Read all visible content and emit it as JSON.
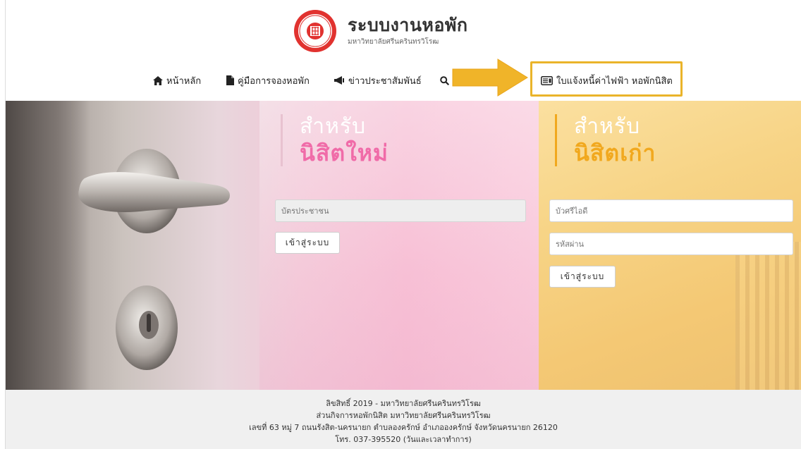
{
  "header": {
    "title": "ระบบงานหอพัก",
    "subtitle": "มหาวิทยาลัยศรีนครินทรวิโรฒ",
    "seal_text": "มหาวิทยาลัยศรีนครินทรวิโรฒ"
  },
  "nav": {
    "home": "หน้าหลัก",
    "manual": "คู่มือการจองหอพัก",
    "news": "ข่าวประชาสัมพันธ์",
    "bill": "ใบแจ้งหนี้ค่าไฟฟ้า หอพักนิสิต",
    "search_partial": "("
  },
  "new_students": {
    "line1": "สำหรับ",
    "line2": "นิสิตใหม่",
    "id_placeholder": "บัตรประชาชน",
    "login_label": "เข้าสู่ระบบ"
  },
  "old_students": {
    "line1": "สำหรับ",
    "line2": "นิสิตเก่า",
    "buasri_placeholder": "บัวศรีไอดี",
    "password_placeholder": "รหัสผ่าน",
    "login_label": "เข้าสู่ระบบ"
  },
  "footer": {
    "copyright": "ลิขสิทธิ์ 2019 - มหาวิทยาลัยศรีนครินทรวิโรฒ",
    "division": "ส่วนกิจการหอพักนิสิต มหาวิทยาลัยศรีนครินทรวิโรฒ",
    "address": "เลขที่ 63 หมู่ 7 ถนนรังสิต-นครนายก ตำบลองครักษ์ อำเภอองครักษ์ จังหวัดนครนายก 26120",
    "phone": "โทร. 037-395520 (วันและเวลาทำการ)"
  },
  "colors": {
    "pink_accent": "#f06ba8",
    "gold_accent": "#f1a81e",
    "highlight_border": "#eab42a"
  }
}
